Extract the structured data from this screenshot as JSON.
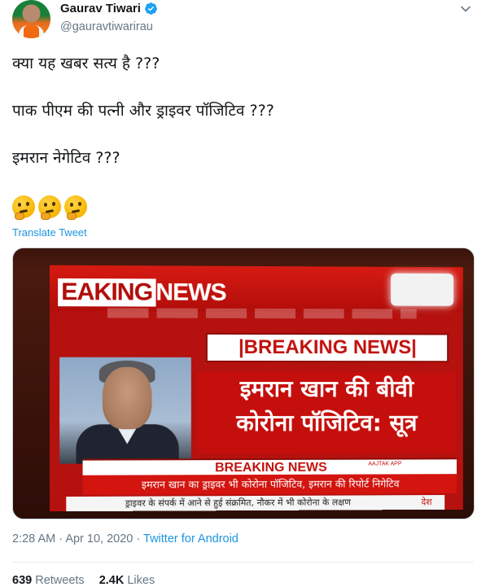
{
  "author": {
    "display_name": "Gaurav Tiwari",
    "handle": "@gauravtiwarirau"
  },
  "tweet": {
    "lines": [
      "क्या यह खबर सत्य है ???",
      "पाक पीएम की पत्नी और ड्राइवर पॉजिटिव ???",
      "इमरान नेगेटिव ???"
    ],
    "emojis": [
      "thinking-face",
      "thinking-face",
      "thinking-face"
    ],
    "translate_label": "Translate Tweet"
  },
  "media": {
    "banner_left": "EAKING",
    "banner_right": "NEWS",
    "breaking_box": "|BREAKING NEWS|",
    "headline_line1": "इमरान खान की बीवी",
    "headline_line2": "कोरोना पॉजिटिव: सूत्र",
    "strap_label": "BREAKING NEWS",
    "channel_tag": "AAJTAK APP",
    "ticker_main": "इमरान खान का ड्राइवर भी कोरोना पॉजिटिव, इमरान की रिपोर्ट निगेटिव",
    "ticker_sub": "ड्राइवर के संपर्क में आने से हुई संक्रमित, नौकर में भी कोरोना के लक्षण",
    "ticker_section": "देश"
  },
  "meta": {
    "time": "2:28 AM",
    "separator1": "·",
    "date": "Apr 10, 2020",
    "separator2": "·",
    "source": "Twitter for Android"
  },
  "stats": {
    "retweets_count": "639",
    "retweets_label": "Retweets",
    "likes_count": "2.4K",
    "likes_label": "Likes"
  },
  "colors": {
    "link": "#1b95e0",
    "secondary_text": "#657786",
    "verified": "#1da1f2"
  }
}
